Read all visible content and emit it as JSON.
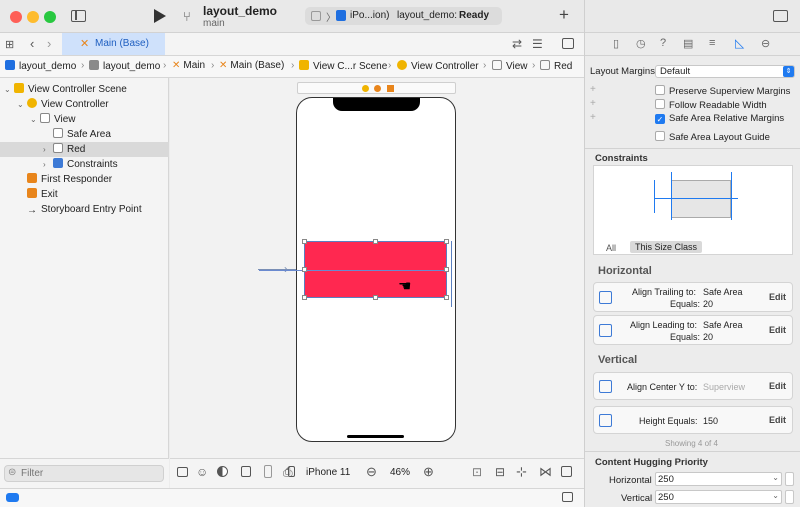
{
  "toolbar": {
    "project_name": "layout_demo",
    "branch": "main",
    "scheme_device": "iPo...ion)",
    "status_project": "layout_demo:",
    "status_state": "Ready"
  },
  "editor_tab": {
    "label": "Main (Base)"
  },
  "breadcrumbs": [
    "layout_demo",
    "layout_demo",
    "Main",
    "Main (Base)",
    "View C...r Scene",
    "View Controller",
    "View",
    "Red"
  ],
  "navigator": {
    "items": [
      {
        "label": "View Controller Scene",
        "indent": 0,
        "disclosure": "v",
        "icon": "scene-icon",
        "color": "#f0b400"
      },
      {
        "label": "View Controller",
        "indent": 1,
        "disclosure": "v",
        "icon": "view-controller-icon",
        "color": "#f0b400"
      },
      {
        "label": "View",
        "indent": 2,
        "disclosure": "v",
        "icon": "view-icon",
        "color": "#888888"
      },
      {
        "label": "Safe Area",
        "indent": 3,
        "disclosure": "",
        "icon": "safe-area-icon",
        "color": "#888888"
      },
      {
        "label": "Red",
        "indent": 3,
        "disclosure": ">",
        "icon": "view-icon",
        "color": "#888888"
      },
      {
        "label": "Constraints",
        "indent": 3,
        "disclosure": ">",
        "icon": "constraints-icon",
        "color": "#3d7ad6"
      },
      {
        "label": "First Responder",
        "indent": 1,
        "disclosure": "",
        "icon": "first-responder-icon",
        "color": "#e8851b"
      },
      {
        "label": "Exit",
        "indent": 1,
        "disclosure": "",
        "icon": "exit-icon",
        "color": "#e8851b"
      },
      {
        "label": "Storyboard Entry Point",
        "indent": 1,
        "disclosure": "",
        "icon": "entry-arrow-icon",
        "color": "#333333"
      }
    ],
    "selected_index": 4
  },
  "filter": {
    "placeholder": "Filter"
  },
  "canvas_bar": {
    "device": "iPhone 11",
    "zoom": "46%"
  },
  "inspector": {
    "layout_margins_label": "Layout Margins",
    "layout_margins_value": "Default",
    "checks": [
      {
        "label": "Preserve Superview Margins",
        "checked": false
      },
      {
        "label": "Follow Readable Width",
        "checked": false
      },
      {
        "label": "Safe Area Relative Margins",
        "checked": true
      },
      {
        "label": "Safe Area Layout Guide",
        "checked": false
      }
    ],
    "constraints_title": "Constraints",
    "size_class_all": "All",
    "size_class_this": "This Size Class",
    "horizontal_title": "Horizontal",
    "vertical_title": "Vertical",
    "constraints": [
      {
        "line1": "Align Trailing to:",
        "value1": "Safe Area",
        "line2": "Equals:",
        "value2": "20",
        "edit": "Edit"
      },
      {
        "line1": "Align Leading to:",
        "value1": "Safe Area",
        "line2": "Equals:",
        "value2": "20",
        "edit": "Edit"
      },
      {
        "line1": "Align Center Y to:",
        "value1": "Superview",
        "line2": "",
        "value2": "",
        "edit": "Edit"
      },
      {
        "line1": "Height Equals:",
        "value1": "150",
        "line2": "",
        "value2": "",
        "edit": "Edit"
      }
    ],
    "showing": "Showing 4 of 4",
    "hugging_title": "Content Hugging Priority",
    "hugging_horizontal_label": "Horizontal",
    "hugging_horizontal_value": "250",
    "hugging_vertical_label": "Vertical",
    "hugging_vertical_value": "250"
  },
  "colors": {
    "accent": "#1f7af0",
    "red_view": "#ff2850",
    "tab_bg": "#cfe1fb"
  }
}
